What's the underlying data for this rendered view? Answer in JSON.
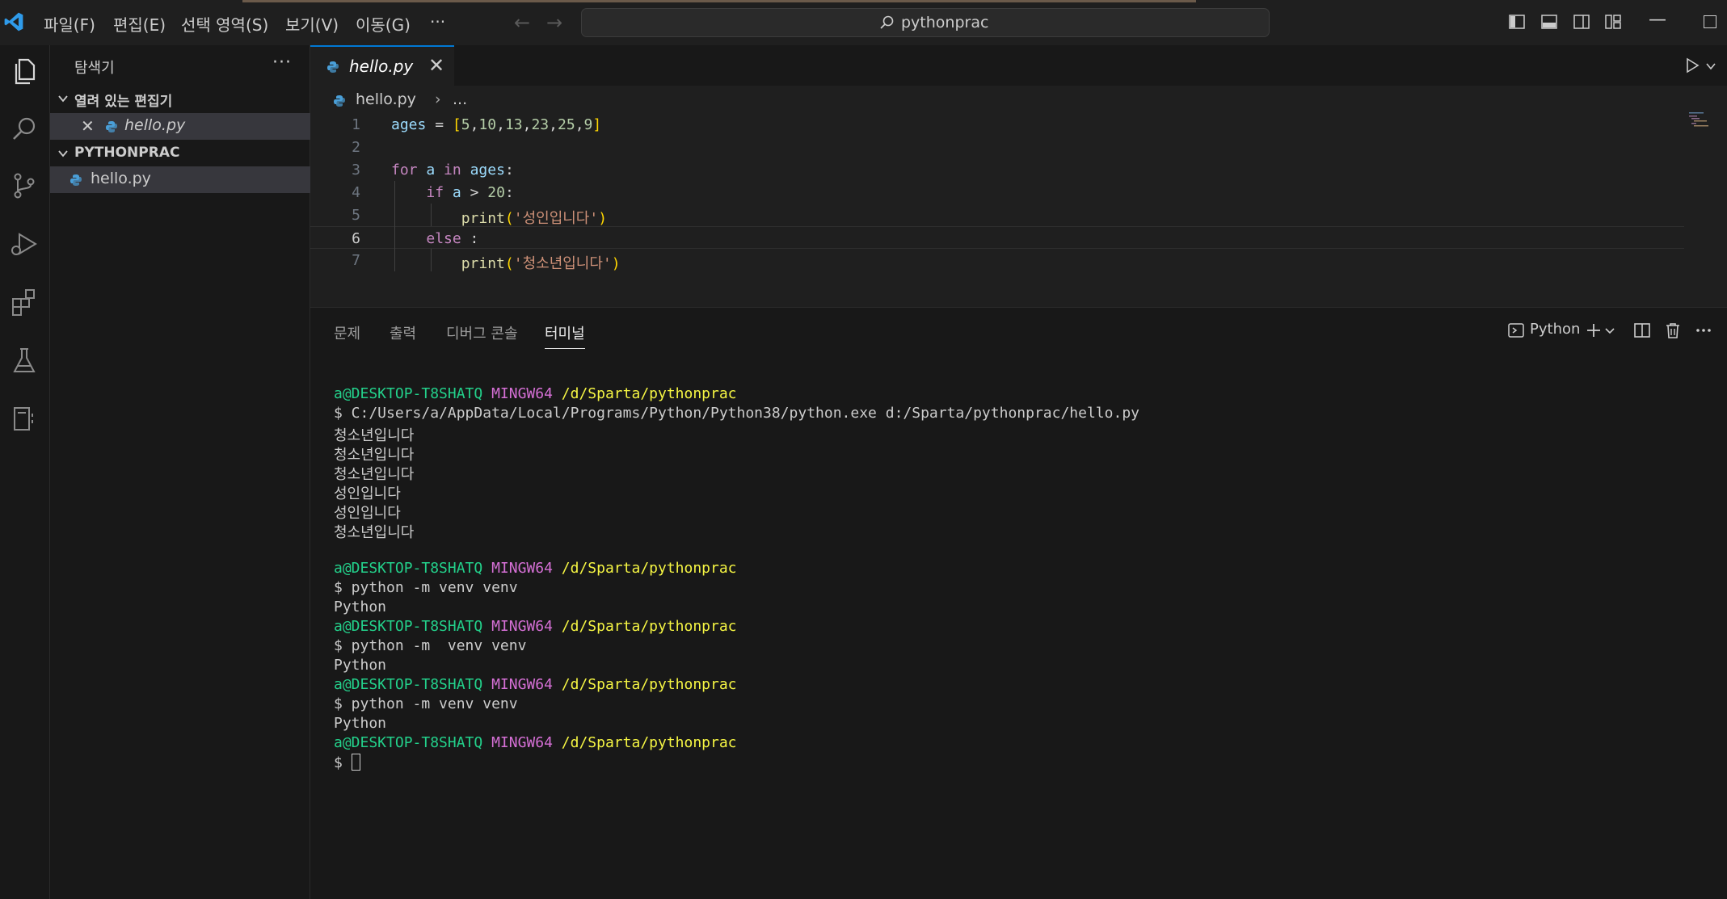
{
  "menu": {
    "items": [
      "파일(F)",
      "편집(E)",
      "선택 영역(S)",
      "보기(V)",
      "이동(G)",
      "···"
    ]
  },
  "command_center": {
    "label": "pythonprac"
  },
  "sidebar": {
    "title": "탐색기",
    "more": "···",
    "open_editors": {
      "header": "열려 있는 편집기",
      "files": [
        {
          "name": "hello.py",
          "close": "✕"
        }
      ]
    },
    "workspace": {
      "header": "PYTHONPRAC",
      "files": [
        {
          "name": "hello.py"
        }
      ]
    }
  },
  "editor": {
    "tab": {
      "label": "hello.py",
      "close": "✕"
    },
    "breadcrumb": {
      "file": "hello.py",
      "separator": "›",
      "more": "..."
    },
    "active_line": 6,
    "lines": [
      {
        "n": "1",
        "tokens": [
          [
            "var",
            "ages"
          ],
          [
            "op",
            " = "
          ],
          [
            "br",
            "["
          ],
          [
            "num",
            "5"
          ],
          [
            "op",
            ","
          ],
          [
            "num",
            "10"
          ],
          [
            "op",
            ","
          ],
          [
            "num",
            "13"
          ],
          [
            "op",
            ","
          ],
          [
            "num",
            "23"
          ],
          [
            "op",
            ","
          ],
          [
            "num",
            "25"
          ],
          [
            "op",
            ","
          ],
          [
            "num",
            "9"
          ],
          [
            "br",
            "]"
          ]
        ]
      },
      {
        "n": "2",
        "tokens": []
      },
      {
        "n": "3",
        "tokens": [
          [
            "kw",
            "for"
          ],
          [
            "op",
            " "
          ],
          [
            "var",
            "a"
          ],
          [
            "op",
            " "
          ],
          [
            "kw",
            "in"
          ],
          [
            "op",
            " "
          ],
          [
            "var",
            "ages"
          ],
          [
            "op",
            ":"
          ]
        ]
      },
      {
        "n": "4",
        "tokens": [
          [
            "op",
            "    "
          ],
          [
            "kw",
            "if"
          ],
          [
            "op",
            " "
          ],
          [
            "var",
            "a"
          ],
          [
            "op",
            " > "
          ],
          [
            "num",
            "20"
          ],
          [
            "op",
            ":"
          ]
        ]
      },
      {
        "n": "5",
        "tokens": [
          [
            "op",
            "        "
          ],
          [
            "fn",
            "print"
          ],
          [
            "br",
            "("
          ],
          [
            "str",
            "'성인입니다'"
          ],
          [
            "br",
            ")"
          ]
        ]
      },
      {
        "n": "6",
        "tokens": [
          [
            "op",
            "    "
          ],
          [
            "kw",
            "else"
          ],
          [
            "op",
            " :"
          ]
        ]
      },
      {
        "n": "7",
        "tokens": [
          [
            "op",
            "        "
          ],
          [
            "fn",
            "print"
          ],
          [
            "br",
            "("
          ],
          [
            "str",
            "'청소년입니다'"
          ],
          [
            "br",
            ")"
          ]
        ]
      }
    ]
  },
  "panel": {
    "tabs": [
      "문제",
      "출력",
      "디버그 콘솔",
      "터미널"
    ],
    "active_tab": 3,
    "terminal_profile": "Python",
    "terminal_lines": [
      {
        "type": "prompt",
        "user": "a@DESKTOP-T8SHATQ",
        "host": "MINGW64",
        "path": "/d/Sparta/pythonprac"
      },
      {
        "type": "text",
        "text": "$ C:/Users/a/AppData/Local/Programs/Python/Python38/python.exe d:/Sparta/pythonprac/hello.py"
      },
      {
        "type": "text",
        "text": "청소년입니다"
      },
      {
        "type": "text",
        "text": "청소년입니다"
      },
      {
        "type": "text",
        "text": "청소년입니다"
      },
      {
        "type": "text",
        "text": "성인입니다"
      },
      {
        "type": "text",
        "text": "성인입니다"
      },
      {
        "type": "text",
        "text": "청소년입니다"
      },
      {
        "type": "text",
        "text": ""
      },
      {
        "type": "prompt",
        "user": "a@DESKTOP-T8SHATQ",
        "host": "MINGW64",
        "path": "/d/Sparta/pythonprac"
      },
      {
        "type": "text",
        "text": "$ python -m venv venv"
      },
      {
        "type": "text",
        "text": "Python"
      },
      {
        "type": "prompt",
        "user": "a@DESKTOP-T8SHATQ",
        "host": "MINGW64",
        "path": "/d/Sparta/pythonprac"
      },
      {
        "type": "text",
        "text": "$ python -m  venv venv"
      },
      {
        "type": "text",
        "text": "Python"
      },
      {
        "type": "prompt",
        "user": "a@DESKTOP-T8SHATQ",
        "host": "MINGW64",
        "path": "/d/Sparta/pythonprac"
      },
      {
        "type": "text",
        "text": "$ python -m venv venv"
      },
      {
        "type": "text",
        "text": "Python"
      },
      {
        "type": "prompt",
        "user": "a@DESKTOP-T8SHATQ",
        "host": "MINGW64",
        "path": "/d/Sparta/pythonprac"
      },
      {
        "type": "input",
        "text": "$ "
      }
    ]
  },
  "colors": {
    "accent": "#0078d4",
    "terminal_user": "#23d18b",
    "terminal_host": "#d670d6",
    "terminal_path": "#f5f543"
  }
}
